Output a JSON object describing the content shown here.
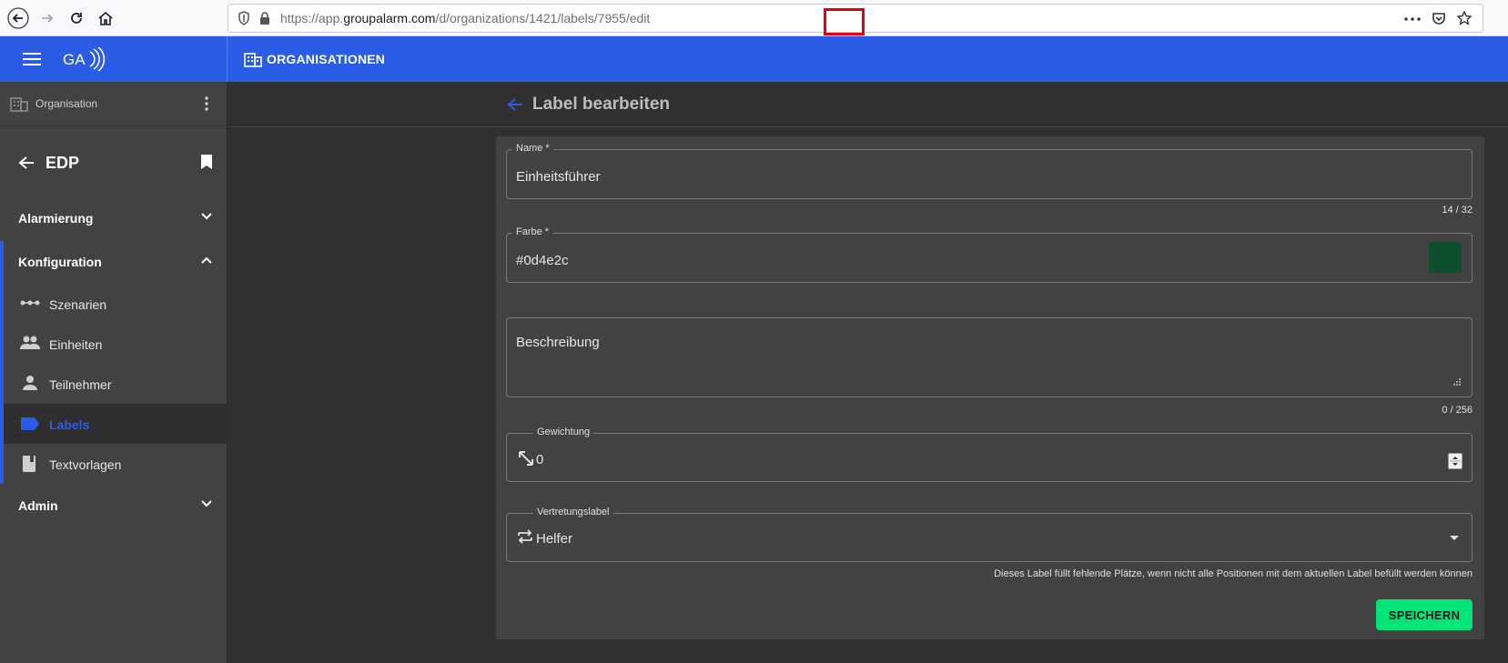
{
  "browser": {
    "url_prefix": "https://app.",
    "url_domain": "groupalarm.com",
    "url_path1": "/d/organizations/1421/labels/",
    "url_id": "7955",
    "url_path2": "/edit"
  },
  "header": {
    "logo": "GA",
    "title": "ORGANISATIONEN"
  },
  "sidebar": {
    "org_label": "Organisation",
    "title": "EDP",
    "sections": {
      "alarmierung": "Alarmierung",
      "konfiguration": "Konfiguration",
      "admin": "Admin"
    },
    "items": [
      {
        "label": "Szenarien",
        "icon": "scenario-icon"
      },
      {
        "label": "Einheiten",
        "icon": "group-icon"
      },
      {
        "label": "Teilnehmer",
        "icon": "person-icon"
      },
      {
        "label": "Labels",
        "icon": "label-icon"
      },
      {
        "label": "Textvorlagen",
        "icon": "book-icon"
      }
    ]
  },
  "page": {
    "title": "Label bearbeiten"
  },
  "form": {
    "name": {
      "label": "Name *",
      "value": "Einheitsführer",
      "counter": "14 / 32"
    },
    "farbe": {
      "label": "Farbe *",
      "value": "#0d4e2c",
      "color": "#0d4e2c"
    },
    "beschreibung": {
      "placeholder": "Beschreibung",
      "counter": "0 / 256"
    },
    "gewichtung": {
      "label": "Gewichtung",
      "value": "0"
    },
    "vertretung": {
      "label": "Vertretungslabel",
      "value": "Helfer",
      "hint": "Dieses Label füllt fehlende Plätze, wenn nicht alle Positionen mit dem aktuellen Label befüllt werden können"
    },
    "save_label": "SPEICHERN"
  },
  "colors": {
    "accent": "#2b5ce6",
    "save": "#00e676"
  }
}
